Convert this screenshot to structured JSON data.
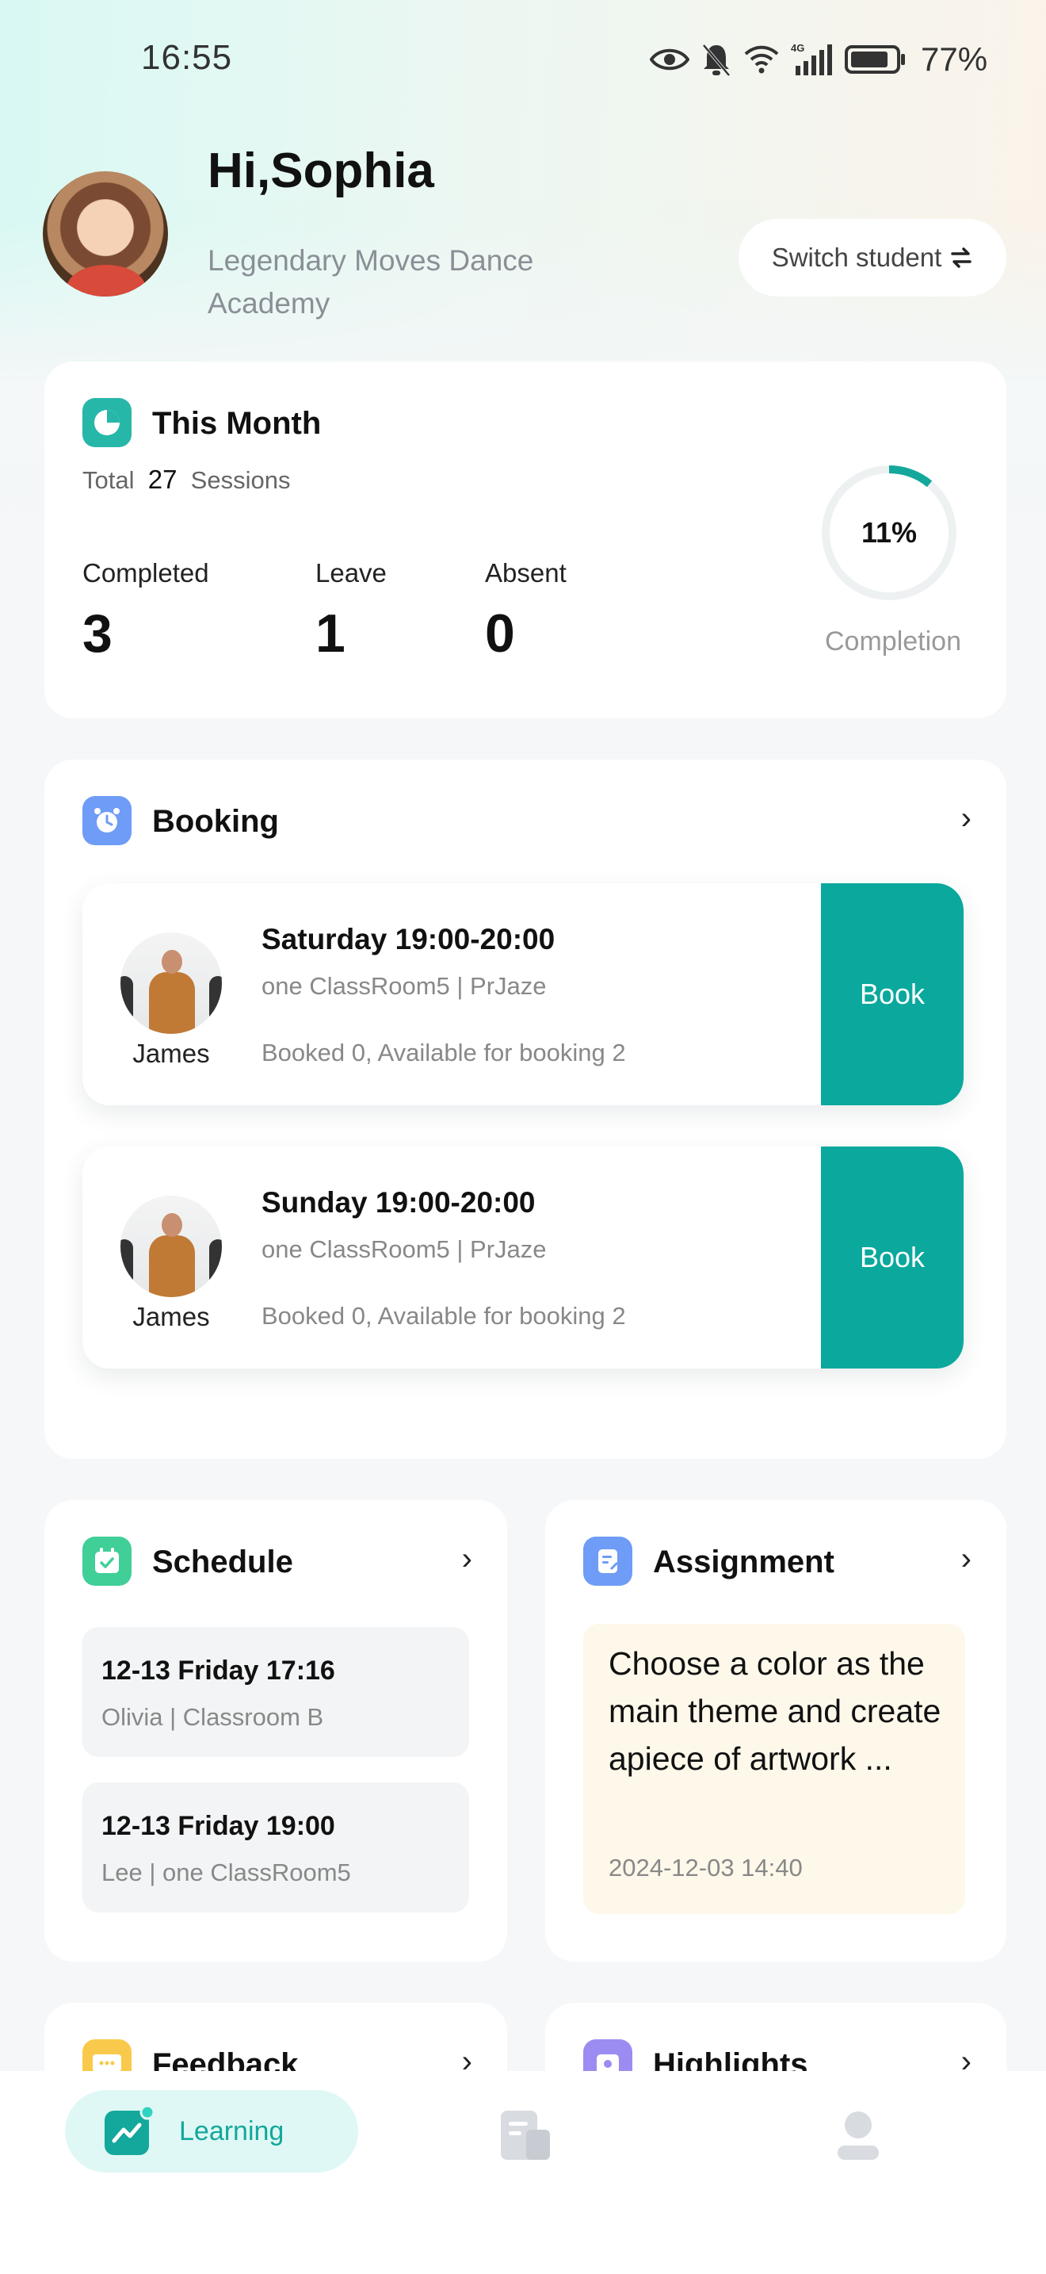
{
  "status_bar": {
    "time": "16:55",
    "battery": "77%",
    "network": "4G"
  },
  "header": {
    "greeting": "Hi,Sophia",
    "academy": "Legendary Moves Dance Academy",
    "switch_label": "Switch student"
  },
  "this_month": {
    "title": "This Month",
    "total_prefix": "Total",
    "total_value": "27",
    "total_suffix": "Sessions",
    "stats": [
      {
        "label": "Completed",
        "value": "3"
      },
      {
        "label": "Leave",
        "value": "1"
      },
      {
        "label": "Absent",
        "value": "0"
      }
    ],
    "completion_value": "11%",
    "completion_fraction": 0.11,
    "completion_label": "Completion"
  },
  "booking": {
    "title": "Booking",
    "items": [
      {
        "teacher": "James",
        "time": "Saturday 19:00-20:00",
        "room": "one ClassRoom5  |  PrJaze",
        "availability": "Booked 0, Available for booking 2",
        "button": "Book"
      },
      {
        "teacher": "James",
        "time": "Sunday 19:00-20:00",
        "room": "one ClassRoom5  |  PrJaze",
        "availability": "Booked 0, Available for booking 2",
        "button": "Book"
      }
    ]
  },
  "schedule": {
    "title": "Schedule",
    "items": [
      {
        "date": "12-13 Friday 17:16",
        "detail": "Olivia  |  Classroom B"
      },
      {
        "date": "12-13 Friday 19:00",
        "detail": "Lee  |  one ClassRoom5"
      }
    ]
  },
  "assignment": {
    "title": "Assignment",
    "text": "Choose a color as the main theme and create apiece of artwork ...",
    "date": "2024-12-03 14:40"
  },
  "feedback": {
    "title": "Feedback"
  },
  "highlights": {
    "title": "Highlights"
  },
  "tabbar": {
    "learning_label": "Learning",
    "icons": [
      "learning-icon",
      "document-icon",
      "profile-icon"
    ]
  },
  "colors": {
    "accent": "#0aa89d",
    "accent_light": "#dff8f5"
  }
}
